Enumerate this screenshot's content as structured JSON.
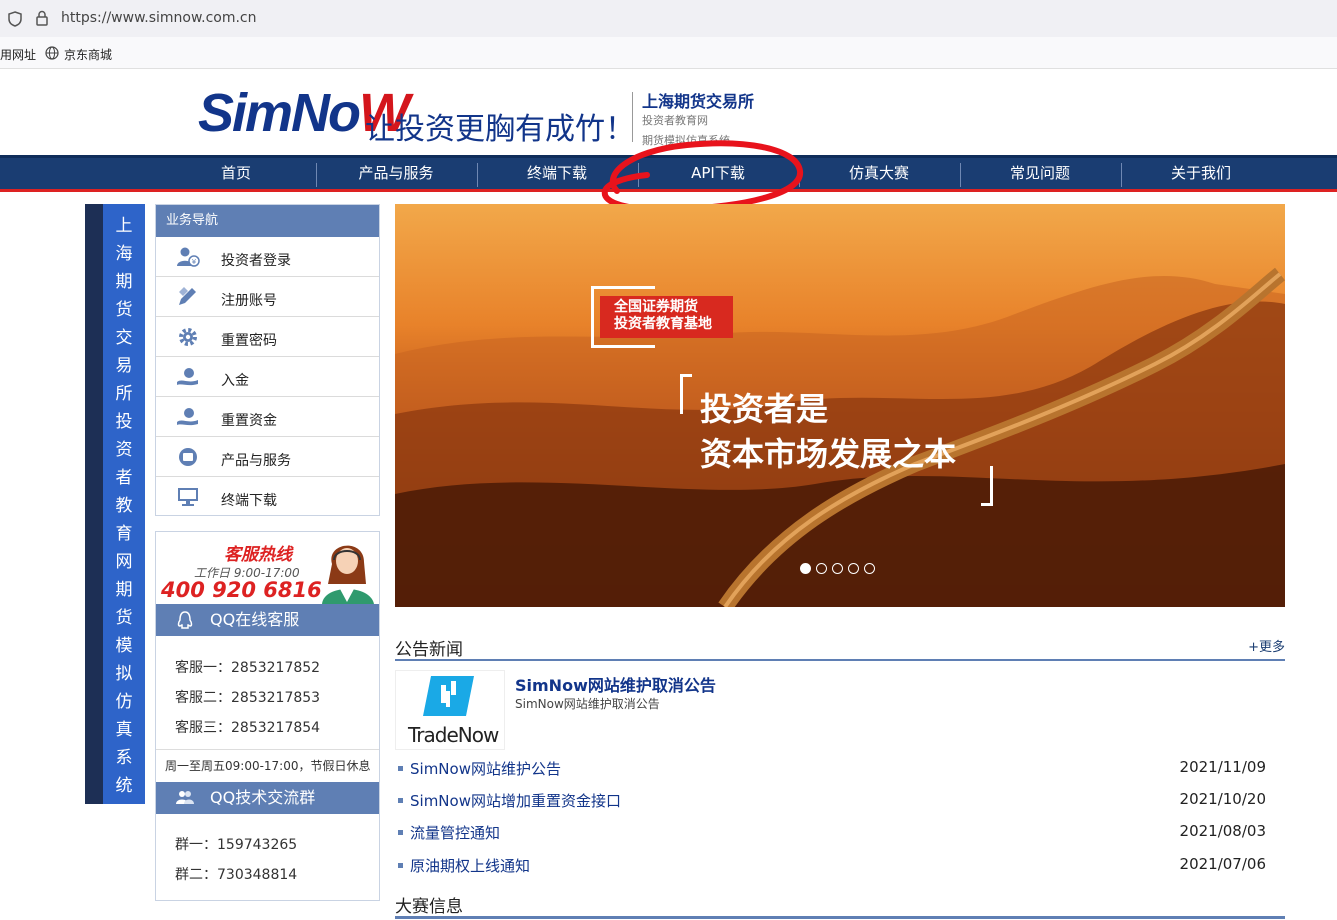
{
  "browser": {
    "url": "https://www.simnow.com.cn",
    "bookmarks": [
      "用网址",
      "京东商城"
    ]
  },
  "header": {
    "logo_main": "SimNo",
    "logo_accent": "W",
    "slogan": "让投资更胸有成竹！",
    "org_name": "上海期货交易所",
    "org_sub1": "投资者教育网",
    "org_sub2": "期货模拟仿真系统"
  },
  "nav": {
    "items": [
      "首页",
      "产品与服务",
      "终端下载",
      "API下载",
      "仿真大赛",
      "常见问题",
      "关于我们"
    ]
  },
  "vertical_banner": {
    "chars": [
      "上",
      "海",
      "期",
      "货",
      "交",
      "易",
      "所",
      "投",
      "资",
      "者",
      "教",
      "育",
      "网",
      "期",
      "货",
      "模",
      "拟",
      "仿",
      "真",
      "系",
      "统"
    ]
  },
  "biznav": {
    "title": "业务导航",
    "items": [
      {
        "label": "投资者登录",
        "icon": "user-login-icon"
      },
      {
        "label": "注册账号",
        "icon": "pen-register-icon"
      },
      {
        "label": "重置密码",
        "icon": "gear-icon"
      },
      {
        "label": "入金",
        "icon": "hand-coin-icon"
      },
      {
        "label": "重置资金",
        "icon": "hand-coin-icon"
      },
      {
        "label": "产品与服务",
        "icon": "product-icon"
      },
      {
        "label": "终端下载",
        "icon": "monitor-icon"
      }
    ]
  },
  "service": {
    "hotline_title": "客服热线",
    "hotline_hours": "工作日 9:00-17:00",
    "hotline_number": "400 920 6816",
    "qq_title": "QQ在线客服",
    "qq_items": [
      "客服一：2853217852",
      "客服二：2853217853",
      "客服三：2853217854"
    ],
    "qq_note": "周一至周五09:00-17:00，节假日休息",
    "group_title": "QQ技术交流群",
    "group_items": [
      "群一：159743265",
      "群二：730348814"
    ]
  },
  "hero": {
    "badge_line1": "全国证券期货",
    "badge_line2": "投资者教育基地",
    "headline1": "投资者是",
    "headline2": "资本市场发展之本",
    "slide_count": 5,
    "active_slide": 1
  },
  "news": {
    "title": "公告新闻",
    "more": "+更多",
    "featured_logo": "TradeNow",
    "featured_title": "SimNow网站维护取消公告",
    "featured_sub": "SimNow网站维护取消公告",
    "rows": [
      {
        "title": "SimNow网站维护公告",
        "date": "2021/11/09"
      },
      {
        "title": "SimNow网站增加重置资金接口",
        "date": "2021/10/20"
      },
      {
        "title": "流量管控通知",
        "date": "2021/08/03"
      },
      {
        "title": "原油期权上线通知",
        "date": "2021/07/06"
      }
    ]
  },
  "match": {
    "title": "大赛信息"
  },
  "colors": {
    "brand_blue": "#12358a",
    "nav_bg": "#1a3d72",
    "panel_head": "#5f7fb4",
    "accent_red": "#d22"
  }
}
